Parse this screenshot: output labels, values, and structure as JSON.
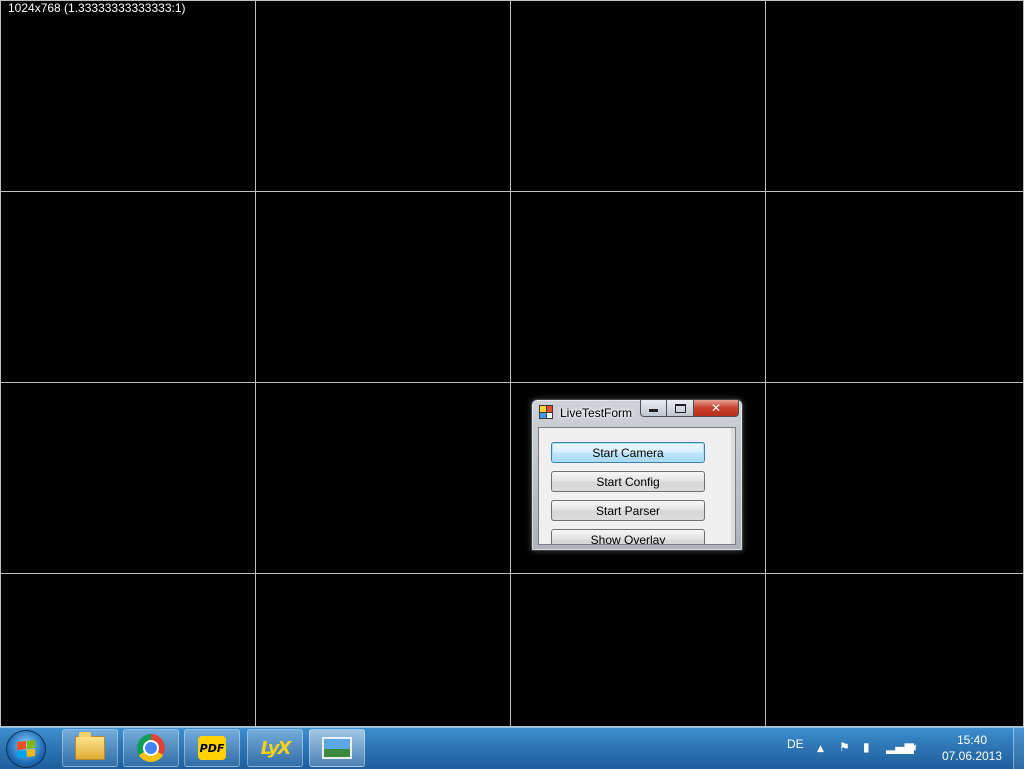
{
  "overlay": {
    "resolution_text": "1024x768 (1.33333333333333:1)"
  },
  "window": {
    "title": "LiveTestForm",
    "buttons": [
      {
        "label": "Start Camera"
      },
      {
        "label": "Start Config"
      },
      {
        "label": "Start Parser"
      },
      {
        "label": "Show Overlay"
      }
    ]
  },
  "taskbar": {
    "pinned": [
      {
        "name": "windows-explorer",
        "icon": "folder-icon"
      },
      {
        "name": "chrome",
        "icon": "chrome-icon"
      },
      {
        "name": "pdf",
        "icon": "pdf-icon",
        "label": "PDF"
      },
      {
        "name": "lyx",
        "icon": "lyx-icon",
        "label": "LyX"
      },
      {
        "name": "live-test-form",
        "icon": "photo-icon"
      }
    ],
    "tray": {
      "language": "DE",
      "time": "15:40",
      "date": "07.06.2013"
    }
  },
  "colors": {
    "background": "#000000",
    "grid": "#bfbfbf",
    "taskbar": "#2f76b5",
    "close_button": "#c7412a"
  }
}
